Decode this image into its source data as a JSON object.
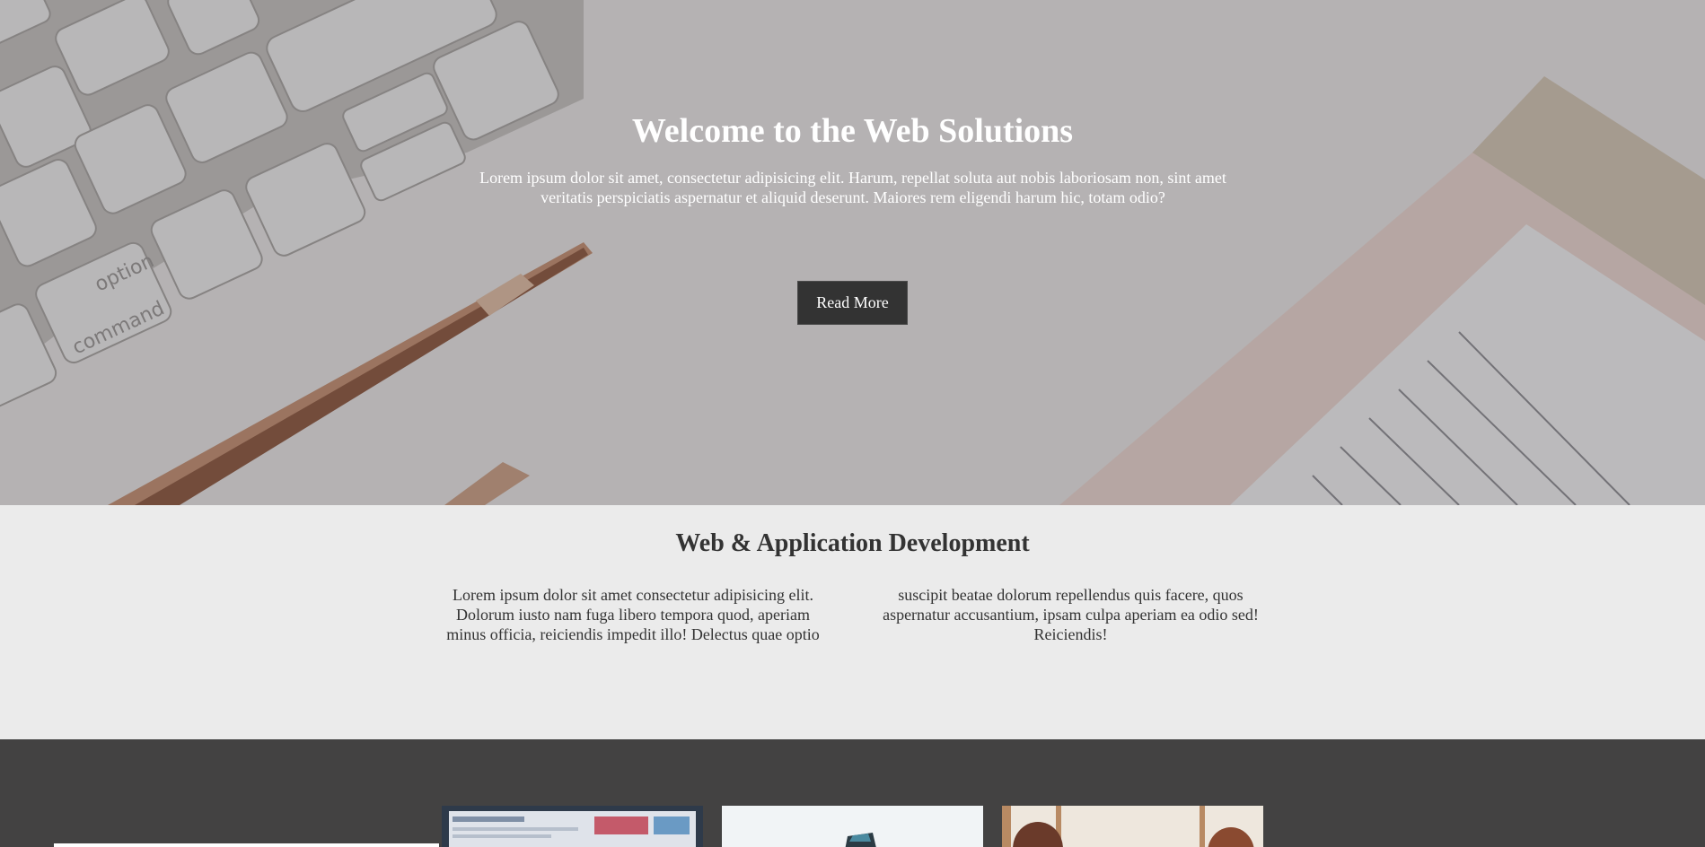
{
  "hero": {
    "title": "Welcome to the Web Solutions",
    "text": "Lorem ipsum dolor sit amet, consectetur adipisicing elit. Harum, repellat soluta aut nobis laboriosam non, sint amet veritatis perspiciatis aspernatur et aliquid deserunt. Maiores rem eligendi harum hic, totam odio?",
    "button_label": "Read More",
    "keyboard_labels": {
      "command": "command",
      "option": "option"
    }
  },
  "services": {
    "title": "Web & Application Development",
    "column_1": "Lorem ipsum dolor sit amet consectetur adipisicing elit. Dolorum iusto nam fuga libero tempora quod, aperiam minus officia, reiciendis impedit illo! Delectus quae optio",
    "column_2": "suscipit beatae dolorum repellendus quis facere, quos aspernatur accusantium, ipsam culpa aperiam ea odio sed! Reiciendis!"
  },
  "gallery": {
    "images": [
      {
        "name": "monitor-screen"
      },
      {
        "name": "phone-desk"
      },
      {
        "name": "people-office"
      }
    ]
  },
  "colors": {
    "hero_overlay": "#8a8889",
    "button_bg": "#333333",
    "services_bg": "#ebebeb",
    "gallery_bg": "#434242",
    "text_dark": "#333333"
  }
}
